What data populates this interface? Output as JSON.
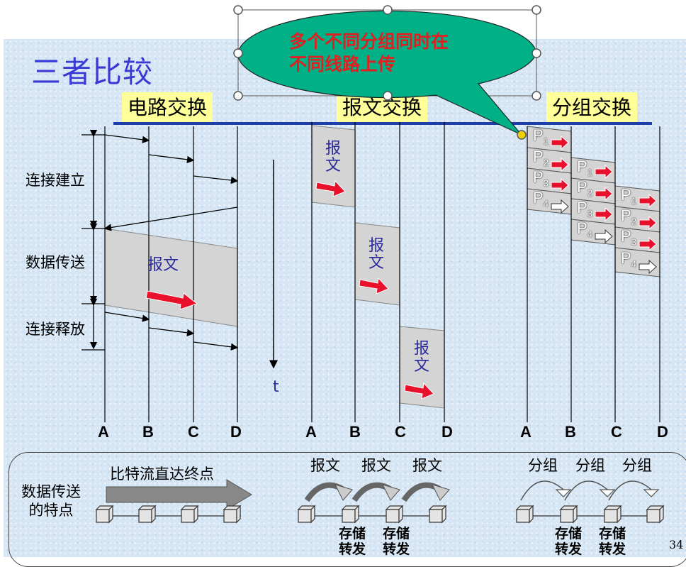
{
  "title": "三者比较",
  "headers": {
    "circuit": "电路交换",
    "message": "报文交换",
    "packet": "分组交换"
  },
  "phases": {
    "setup": "连接建立",
    "transfer": "数据传送",
    "release": "连接释放"
  },
  "nodes": [
    "A",
    "B",
    "C",
    "D"
  ],
  "time_label": "t",
  "message_label": "报文",
  "message_chars": [
    "报",
    "文"
  ],
  "callout": {
    "line1": "多个不同分组同时在",
    "line2": "不同线路上传"
  },
  "packets": {
    "p1": "P1",
    "p2": "P2",
    "p3": "P3",
    "p4": "P4"
  },
  "bottom": {
    "row_label_line1": "数据传送",
    "row_label_line2": "的特点",
    "circuit_feature": "比特流直达终点",
    "message_label": "报文",
    "packet_label": "分组",
    "store": "存储",
    "forward": "转发"
  },
  "page_number": "34",
  "colors": {
    "title": "#3a3ad4",
    "header_bg": "#ffff99",
    "rule": "#1f3fa8",
    "callout_fill": "#00b087",
    "callout_text": "#e02020",
    "arrow_red": "#e8102a",
    "gray_box": "#d4d4d4"
  }
}
